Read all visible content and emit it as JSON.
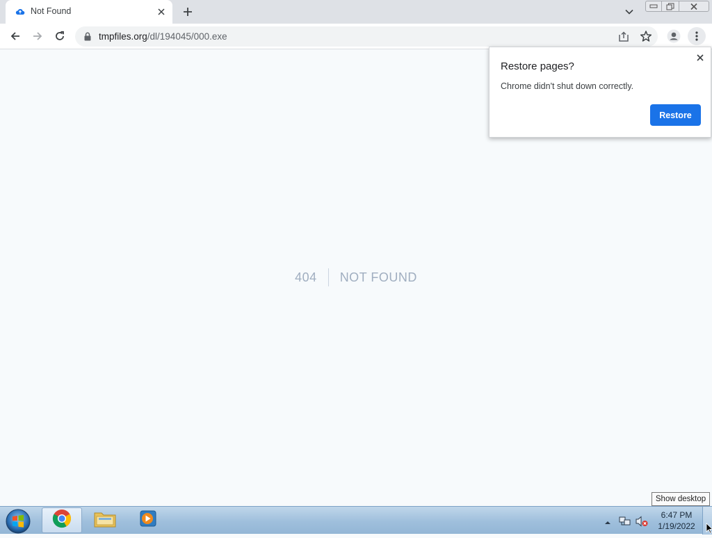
{
  "browser": {
    "tab": {
      "title": "Not Found",
      "favicon": "cloud-icon"
    },
    "window_controls": [
      "minimize-icon",
      "restore-icon",
      "close-icon"
    ],
    "address_bar": {
      "host": "tmpfiles.org",
      "path": "/dl/194045/000.exe"
    }
  },
  "page": {
    "code": "404",
    "message": "NOT FOUND"
  },
  "restore_bubble": {
    "title": "Restore pages?",
    "text": "Chrome didn't shut down correctly.",
    "button": "Restore"
  },
  "taskbar": {
    "apps": [
      "chrome-icon",
      "file-explorer-icon",
      "media-player-icon"
    ],
    "clock": {
      "time": "6:47 PM",
      "date": "1/19/2022"
    },
    "tooltip": "Show desktop"
  },
  "colors": {
    "accent": "#1a73e8",
    "page_background": "#f7fafc",
    "muted_text": "#a0aec0"
  }
}
